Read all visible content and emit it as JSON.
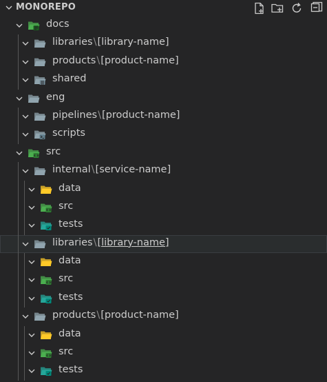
{
  "explorer": {
    "title": "MONOREPO",
    "actions": [
      "new-file-icon",
      "new-folder-icon",
      "refresh-icon",
      "collapse-all-icon"
    ]
  },
  "colors": {
    "background": "#252526",
    "text": "#cccccc",
    "folder": "#90a4ae",
    "folder_data": "#ffca28",
    "folder_src": "#4caf50",
    "folder_tests": "#26a69a",
    "highlight": "#2a2d2e"
  },
  "tree": [
    {
      "level": 0,
      "label": "docs",
      "icon": "docs-folder-icon",
      "expanded": true
    },
    {
      "level": 1,
      "label": "libraries",
      "suffix": "[library-name]",
      "icon": "folder-icon",
      "expanded": true
    },
    {
      "level": 1,
      "label": "products",
      "suffix": "[product-name]",
      "icon": "folder-icon",
      "expanded": true
    },
    {
      "level": 1,
      "label": "shared",
      "icon": "shared-folder-icon",
      "expanded": true
    },
    {
      "level": 0,
      "label": "eng",
      "icon": "folder-icon",
      "expanded": true
    },
    {
      "level": 1,
      "label": "pipelines",
      "suffix": "[product-name]",
      "icon": "folder-icon",
      "expanded": true
    },
    {
      "level": 1,
      "label": "scripts",
      "icon": "scripts-folder-icon",
      "expanded": true
    },
    {
      "level": 0,
      "label": "src",
      "icon": "src-folder-icon",
      "expanded": true
    },
    {
      "level": 1,
      "label": "internal",
      "suffix": "[service-name]",
      "icon": "folder-icon",
      "expanded": true
    },
    {
      "level": 2,
      "label": "data",
      "icon": "data-folder-icon",
      "expanded": true
    },
    {
      "level": 2,
      "label": "src",
      "icon": "src-folder-icon",
      "expanded": true
    },
    {
      "level": 2,
      "label": "tests",
      "icon": "tests-folder-icon",
      "expanded": true
    },
    {
      "level": 1,
      "label": "libraries",
      "suffix": "[library-name]",
      "icon": "folder-icon",
      "expanded": true,
      "highlighted": true
    },
    {
      "level": 2,
      "label": "data",
      "icon": "data-folder-icon",
      "expanded": true
    },
    {
      "level": 2,
      "label": "src",
      "icon": "src-folder-icon",
      "expanded": true
    },
    {
      "level": 2,
      "label": "tests",
      "icon": "tests-folder-icon",
      "expanded": true
    },
    {
      "level": 1,
      "label": "products",
      "suffix": "[product-name]",
      "icon": "folder-icon",
      "expanded": true
    },
    {
      "level": 2,
      "label": "data",
      "icon": "data-folder-icon",
      "expanded": true
    },
    {
      "level": 2,
      "label": "src",
      "icon": "src-folder-icon",
      "expanded": true
    },
    {
      "level": 2,
      "label": "tests",
      "icon": "tests-folder-icon",
      "expanded": true
    }
  ]
}
